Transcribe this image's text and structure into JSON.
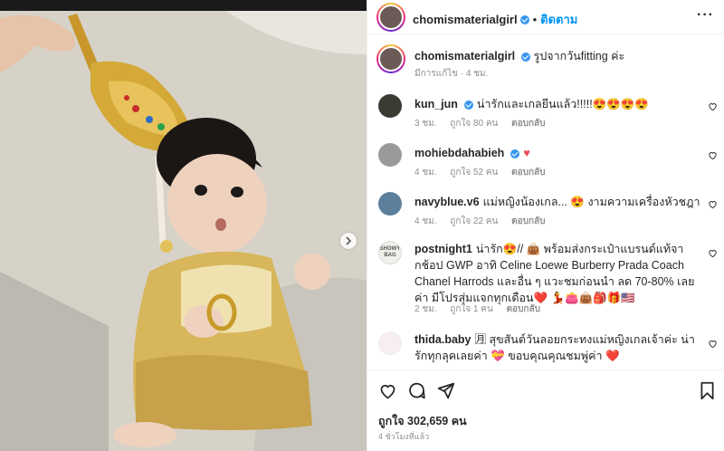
{
  "post": {
    "username": "chomismaterialgirl",
    "follow_label": "ติดตาม",
    "dot": "•",
    "more_label": "···"
  },
  "caption": {
    "username": "chomismaterialgirl",
    "text": "รูปจากวันfitting ค่ะ",
    "meta": "มีการแก้ไข · 4 ชม."
  },
  "comments": [
    {
      "username": "kun_jun",
      "verified": true,
      "text": "น่ารักและเกลยีนแล้ว!!!!!😍😍😍😍",
      "time": "3 ชม.",
      "likes": "ถูกใจ 80 คน",
      "reply": "ตอบกลับ"
    },
    {
      "username": "mohiebdahabieh",
      "verified": true,
      "text": "♥",
      "time": "4 ชม.",
      "likes": "ถูกใจ 52 คน",
      "reply": "ตอบกลับ"
    },
    {
      "username": "navyblue.v6",
      "verified": false,
      "text": "แม่หญิงน้องเกล... 😍 งามความเครื่องหัวชฎา",
      "time": "4 ชม.",
      "likes": "ถูกใจ 22 คน",
      "reply": "ตอบกลับ"
    },
    {
      "username": "postnight1",
      "verified": false,
      "avatar_text": "SHOWY BAG",
      "text": "น่ารัก😍// 👜 พร้อมส่งกระเป๋าแบรนด์แท้จากช้อป GWP อาทิ Celine Loewe Burberry Prada Coach Chanel Harrods และอื่น ๆ แวะชมก่อนนำ ลด 70-80% เลยค่า มีโปรสุ่มแจกทุกเดือน❤️ 💃👛👜🎒🎁🇺🇸",
      "time": "2 ชม.",
      "likes": "ถูกใจ 1 คน",
      "reply": "ตอบกลับ"
    },
    {
      "username": "thida.baby",
      "verified": false,
      "text": "🈷 สุขสันต์วันลอยกระทงแม่หญิงเกลเจ้าค่ะ น่ารักทุกลุคเลยค่า 💝 ขอบคุณคุณชมพู่ค่า ❤️",
      "time": "",
      "likes": "",
      "reply": ""
    }
  ],
  "footer": {
    "likes": "ถูกใจ 302,659 คน",
    "time": "4 ชั่วโมงที่แล้ว"
  },
  "icons": {
    "like": "heart-icon",
    "comment": "comment-icon",
    "share": "share-icon",
    "save": "bookmark-icon",
    "next": "chevron-right-icon"
  },
  "colors": {
    "accent": "#0095f6",
    "verified": "#3897f0",
    "heart": "#ed4956"
  }
}
